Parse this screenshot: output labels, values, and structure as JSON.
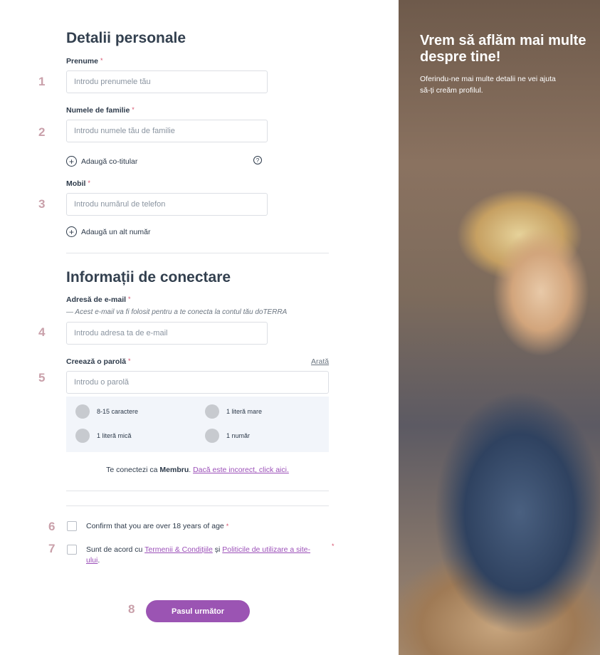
{
  "personal": {
    "title": "Detalii personale",
    "first_name_label": "Prenume",
    "first_name_placeholder": "Introdu prenumele tău",
    "last_name_label": "Numele de familie",
    "last_name_placeholder": "Introdu numele tău de familie",
    "add_coholder": "Adaugă co-titular",
    "mobile_label": "Mobil",
    "mobile_placeholder": "Introdu numărul de telefon",
    "add_number": "Adaugă un alt număr",
    "required_mark": "*"
  },
  "login": {
    "title": "Informații de conectare",
    "email_label": "Adresă de e-mail",
    "email_note": "— Acest e-mail va fi folosit pentru a te conecta la contul tău doTERRA",
    "email_placeholder": "Introdu adresa ta de e-mail",
    "password_label": "Creează o parolă",
    "show_label": "Arată",
    "password_placeholder": "Introdu o parolă",
    "requirements": [
      "8-15 caractere",
      "1 literă mare",
      "1 literă mică",
      "1 număr"
    ],
    "member_prefix": "Te conectezi ca",
    "member_role": "Membru",
    "member_link": "Dacă este incorect, click aici."
  },
  "consent": {
    "age_text": "Confirm that you are over 18 years of age",
    "terms_prefix": "Sunt de acord cu",
    "terms_link": "Termenii & Condițiile",
    "terms_and": "și",
    "policy_link": "Politicile de utilizare a site-ului",
    "terms_suffix": "."
  },
  "next_button": "Pasul următor",
  "steps": [
    "1",
    "2",
    "3",
    "4",
    "5",
    "6",
    "7",
    "8"
  ],
  "hero": {
    "title": "Vrem să aflăm mai multe despre tine!",
    "subtitle": "Oferindu-ne mai multe detalii ne vei ajuta să-ți creăm profilul."
  },
  "icons": {
    "plus": "plus-circle-icon",
    "help": "question-circle-icon"
  },
  "colors": {
    "accent": "#9b54b3",
    "required": "#d64f6b",
    "step": "#c9a0aa"
  }
}
